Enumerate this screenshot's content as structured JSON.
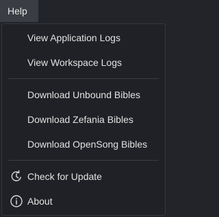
{
  "menubar": {
    "help_label": "Help"
  },
  "help_menu": {
    "items": [
      {
        "label": "View Application Logs"
      },
      {
        "label": "View Workspace Logs"
      },
      {
        "label": "Download Unbound Bibles"
      },
      {
        "label": "Download Zefania Bibles"
      },
      {
        "label": "Download OpenSong Bibles"
      },
      {
        "label": "Check for Update",
        "icon": "refresh-icon"
      },
      {
        "label": "About",
        "icon": "info-icon"
      }
    ]
  },
  "colors": {
    "background": "#222429",
    "menubar_active": "#3a3d43",
    "text": "#e2e2e2",
    "separator": "#3a3d43"
  }
}
